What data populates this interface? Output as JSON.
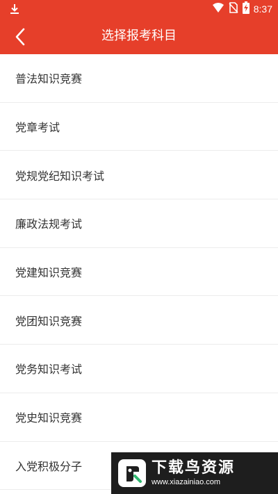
{
  "status_bar": {
    "time": "8:37",
    "icons": [
      "download-icon",
      "wifi-icon",
      "no-sim-icon",
      "battery-charging-icon"
    ]
  },
  "toolbar": {
    "title": "选择报考科目",
    "back_icon": "chevron-left-icon"
  },
  "exam_subjects": [
    "普法知识竞赛",
    "党章考试",
    "党规党纪知识考试",
    "廉政法规考试",
    "党建知识竞赛",
    "党团知识竞赛",
    "党务知识考试",
    "党史知识竞赛",
    "入党积极分子"
  ],
  "watermark": {
    "title": "下载鸟资源",
    "url": "www.xiazainiao.com"
  },
  "colors": {
    "header": "#e63f2a",
    "text": "#333333",
    "divider": "#ececec"
  }
}
